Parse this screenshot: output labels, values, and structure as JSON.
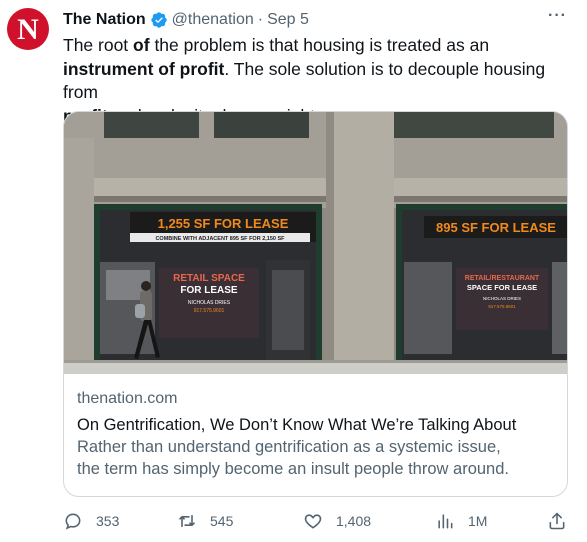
{
  "author": {
    "name": "The Nation",
    "handle": "@thenation",
    "separator": "·",
    "date": "Sep 5",
    "avatar_letter": "N",
    "avatar_color": "#d0112b",
    "verified_color": "#1d9bf0"
  },
  "more_label": "···",
  "tweet_text": [
    {
      "text": "The root ",
      "bold": false
    },
    {
      "text": "of",
      "bold": true
    },
    {
      "text": " the problem is that housing is treated as an ",
      "bold": false
    },
    {
      "text": "instrument of profit",
      "bold": true
    },
    {
      "text": ". The sole solution is to decouple housing from ",
      "bold": false
    },
    {
      "text": "profit",
      "bold": true
    },
    {
      "text": " and make it a human right.",
      "bold": false
    }
  ],
  "card": {
    "image_signs": {
      "sign1_main": "1,255 SF FOR LEASE",
      "sign1_sub": "COMBINE WITH ADJACENT 895 SF FOR 2,150 SF",
      "sign2_main": "895 SF FOR LEASE",
      "retail1_title": "RETAIL SPACE",
      "retail1_sub": "FOR LEASE",
      "retail1_broker": "NICHOLAS DRIES",
      "retail1_phone": "917.575.9601",
      "retail2_title": "RETAIL/RESTAURANT",
      "retail2_sub": "SPACE FOR LEASE",
      "retail2_broker": "NICHOLAS DRIES",
      "retail2_phone": "917.575.9601"
    },
    "domain": "thenation.com",
    "title": "On Gentrification, We Don’t Know What We’re Talking About",
    "description_line1": "Rather than understand gentrification as a systemic issue,",
    "description_line2": "the term has simply become an insult people throw around."
  },
  "actions": {
    "replies": "353",
    "retweets": "545",
    "likes": "1,408",
    "views": "1M"
  }
}
